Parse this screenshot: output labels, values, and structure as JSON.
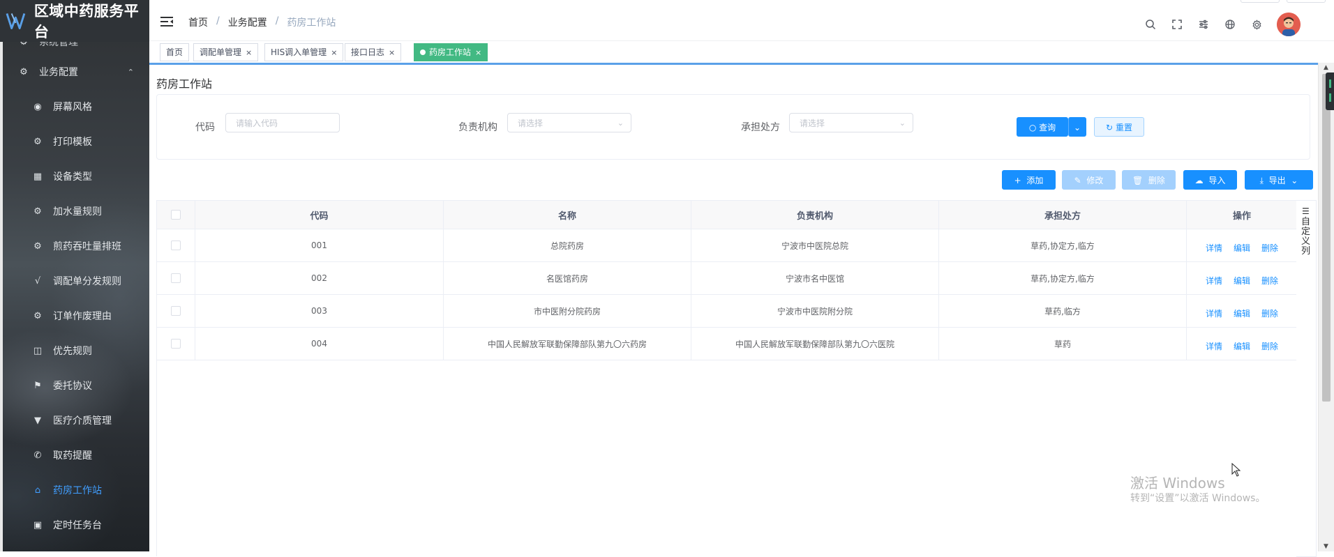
{
  "app": {
    "title": "区域中药服务平台"
  },
  "sidebar": {
    "items": [
      {
        "label": "系统管理",
        "icon": "gear-icon",
        "type": "group",
        "arrow": "up"
      },
      {
        "label": "业务配置",
        "icon": "gear-icon",
        "type": "group",
        "arrow": "up"
      },
      {
        "label": "屏幕风格",
        "icon": "palette-icon",
        "type": "sub"
      },
      {
        "label": "打印模板",
        "icon": "gear-icon",
        "type": "sub"
      },
      {
        "label": "设备类型",
        "icon": "grid-icon",
        "type": "sub"
      },
      {
        "label": "加水量规则",
        "icon": "gear-icon",
        "type": "sub"
      },
      {
        "label": "煎药吞吐量排班",
        "icon": "gear-icon",
        "type": "sub"
      },
      {
        "label": "调配单分发规则",
        "icon": "check-list-icon",
        "type": "sub"
      },
      {
        "label": "订单作废理由",
        "icon": "gear-icon",
        "type": "sub"
      },
      {
        "label": "优先规则",
        "icon": "inbox-icon",
        "type": "sub"
      },
      {
        "label": "委托协议",
        "icon": "flag-icon",
        "type": "sub"
      },
      {
        "label": "医疗介质管理",
        "icon": "stamp-icon",
        "type": "sub"
      },
      {
        "label": "取药提醒",
        "icon": "phone-icon",
        "type": "sub"
      },
      {
        "label": "药房工作站",
        "icon": "home-icon",
        "type": "sub",
        "active": true
      },
      {
        "label": "定时任务台",
        "icon": "monitor-icon",
        "type": "sub"
      }
    ]
  },
  "header": {
    "breadcrumb": [
      "首页",
      "业务配置",
      "药房工作站"
    ],
    "icons": [
      "search-icon",
      "fullscreen-icon",
      "sliders-icon",
      "globe-icon",
      "settings-icon"
    ]
  },
  "tags": [
    {
      "label": "首页",
      "closable": false
    },
    {
      "label": "调配单管理",
      "closable": true
    },
    {
      "label": "HIS调入单管理",
      "closable": true
    },
    {
      "label": "接口日志",
      "closable": true
    },
    {
      "label": "药房工作站",
      "closable": true,
      "active": true
    }
  ],
  "page": {
    "title": "药房工作站"
  },
  "search": {
    "code_label": "代码",
    "code_placeholder": "请输入代码",
    "org_label": "负责机构",
    "org_placeholder": "请选择",
    "rx_label": "承担处方",
    "rx_placeholder": "请选择",
    "query_label": "查询",
    "reset_label": "重置"
  },
  "toolbar": {
    "add_label": "添加",
    "edit_label": "修改",
    "delete_label": "删除",
    "import_label": "导入",
    "export_label": "导出"
  },
  "table": {
    "headers": [
      "代码",
      "名称",
      "负责机构",
      "承担处方",
      "操作"
    ],
    "custom_column_label": "自定义列",
    "actions": [
      "详情",
      "编辑",
      "删除"
    ],
    "rows": [
      {
        "code": "001",
        "name": "总院药房",
        "org": "宁波市中医院总院",
        "rx": "草药,协定方,临方"
      },
      {
        "code": "002",
        "name": "名医馆药房",
        "org": "宁波市名中医馆",
        "rx": "草药,协定方,临方"
      },
      {
        "code": "003",
        "name": "市中医附分院药房",
        "org": "宁波市中医院附分院",
        "rx": "草药,临方"
      },
      {
        "code": "004",
        "name": "中国人民解放军联勤保障部队第九〇六药房",
        "org": "中国人民解放军联勤保障部队第九〇六医院",
        "rx": "草药"
      }
    ]
  },
  "watermark": {
    "line1": "激活 Windows",
    "line2": "转到“设置”以激活 Windows。"
  },
  "colors": {
    "primary": "#1890ff",
    "active_tag": "#42b983",
    "sidebar_active": "#409eff"
  }
}
